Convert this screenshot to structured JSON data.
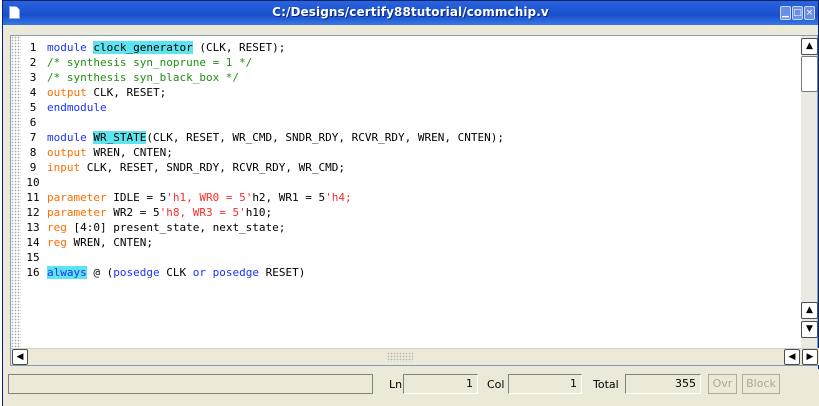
{
  "window": {
    "title": "C:/Designs/certify88tutorial/commchip.v"
  },
  "colors": {
    "keyword": "#1b32ff",
    "type_keyword": "#ff6d00",
    "comment": "#1f8f12",
    "number": "#ff2b2b",
    "highlight": "#5ee4ee",
    "titlebar": "#1e56d3"
  },
  "editor": {
    "line_numbers": [
      "1",
      "2",
      "3",
      "4",
      "5",
      "6",
      "7",
      "8",
      "9",
      "10",
      "11",
      "12",
      "13",
      "14",
      "15",
      "16"
    ],
    "lines": [
      [
        {
          "t": "module ",
          "c": "kw"
        },
        {
          "t": "clock_generator",
          "c": "hl"
        },
        {
          "t": " (CLK, RESET);"
        }
      ],
      [
        {
          "t": "/* synthesis syn_noprune = 1 */",
          "c": "cm"
        }
      ],
      [
        {
          "t": "/* synthesis syn_black_box */",
          "c": "cm"
        }
      ],
      [
        {
          "t": "output",
          "c": "kw2"
        },
        {
          "t": " CLK, RESET;"
        }
      ],
      [
        {
          "t": "endmodule",
          "c": "kw"
        }
      ],
      [],
      [
        {
          "t": "module ",
          "c": "kw"
        },
        {
          "t": "WR_STATE",
          "c": "hl"
        },
        {
          "t": "(CLK, RESET, WR_CMD, SNDR_RDY, RCVR_RDY, WREN, CNTEN);"
        }
      ],
      [
        {
          "t": "output",
          "c": "kw2"
        },
        {
          "t": " WREN, CNTEN;"
        }
      ],
      [
        {
          "t": "input",
          "c": "kw2"
        },
        {
          "t": " CLK, RESET, SNDR_RDY, RCVR_RDY, WR_CMD;"
        }
      ],
      [],
      [
        {
          "t": "parameter",
          "c": "kw2"
        },
        {
          "t": " IDLE = 5"
        },
        {
          "t": "'h1, WR0 = 5'",
          "c": "num"
        },
        {
          "t": "h2, WR1 = 5"
        },
        {
          "t": "'h4;",
          "c": "num"
        }
      ],
      [
        {
          "t": "parameter",
          "c": "kw2"
        },
        {
          "t": " WR2 = 5"
        },
        {
          "t": "'h8, WR3 = 5'",
          "c": "num"
        },
        {
          "t": "h10;"
        }
      ],
      [
        {
          "t": "reg",
          "c": "kw2"
        },
        {
          "t": " [4:0] present_state, next_state;"
        }
      ],
      [
        {
          "t": "reg",
          "c": "kw2"
        },
        {
          "t": " WREN, CNTEN;"
        }
      ],
      [],
      [
        {
          "t": "always",
          "c": "kw hl"
        },
        {
          "t": " @ ("
        },
        {
          "t": "posedge",
          "c": "kw"
        },
        {
          "t": " CLK "
        },
        {
          "t": "or",
          "c": "kw"
        },
        {
          "t": " "
        },
        {
          "t": "posedge",
          "c": "kw"
        },
        {
          "t": " RESET)"
        }
      ]
    ]
  },
  "status": {
    "message": "",
    "ln_label": "Ln",
    "ln_value": "1",
    "col_label": "Col",
    "col_value": "1",
    "total_label": "Total",
    "total_value": "355",
    "ovr_label": "Ovr",
    "block_label": "Block"
  },
  "icons": {
    "app": "document-icon",
    "minimize": "minimize-icon",
    "maximize": "maximize-icon",
    "close": "close-icon",
    "scroll_up": "arrow-up-icon",
    "scroll_down": "arrow-down-icon",
    "scroll_left": "arrow-left-icon",
    "scroll_right": "arrow-right-icon"
  }
}
